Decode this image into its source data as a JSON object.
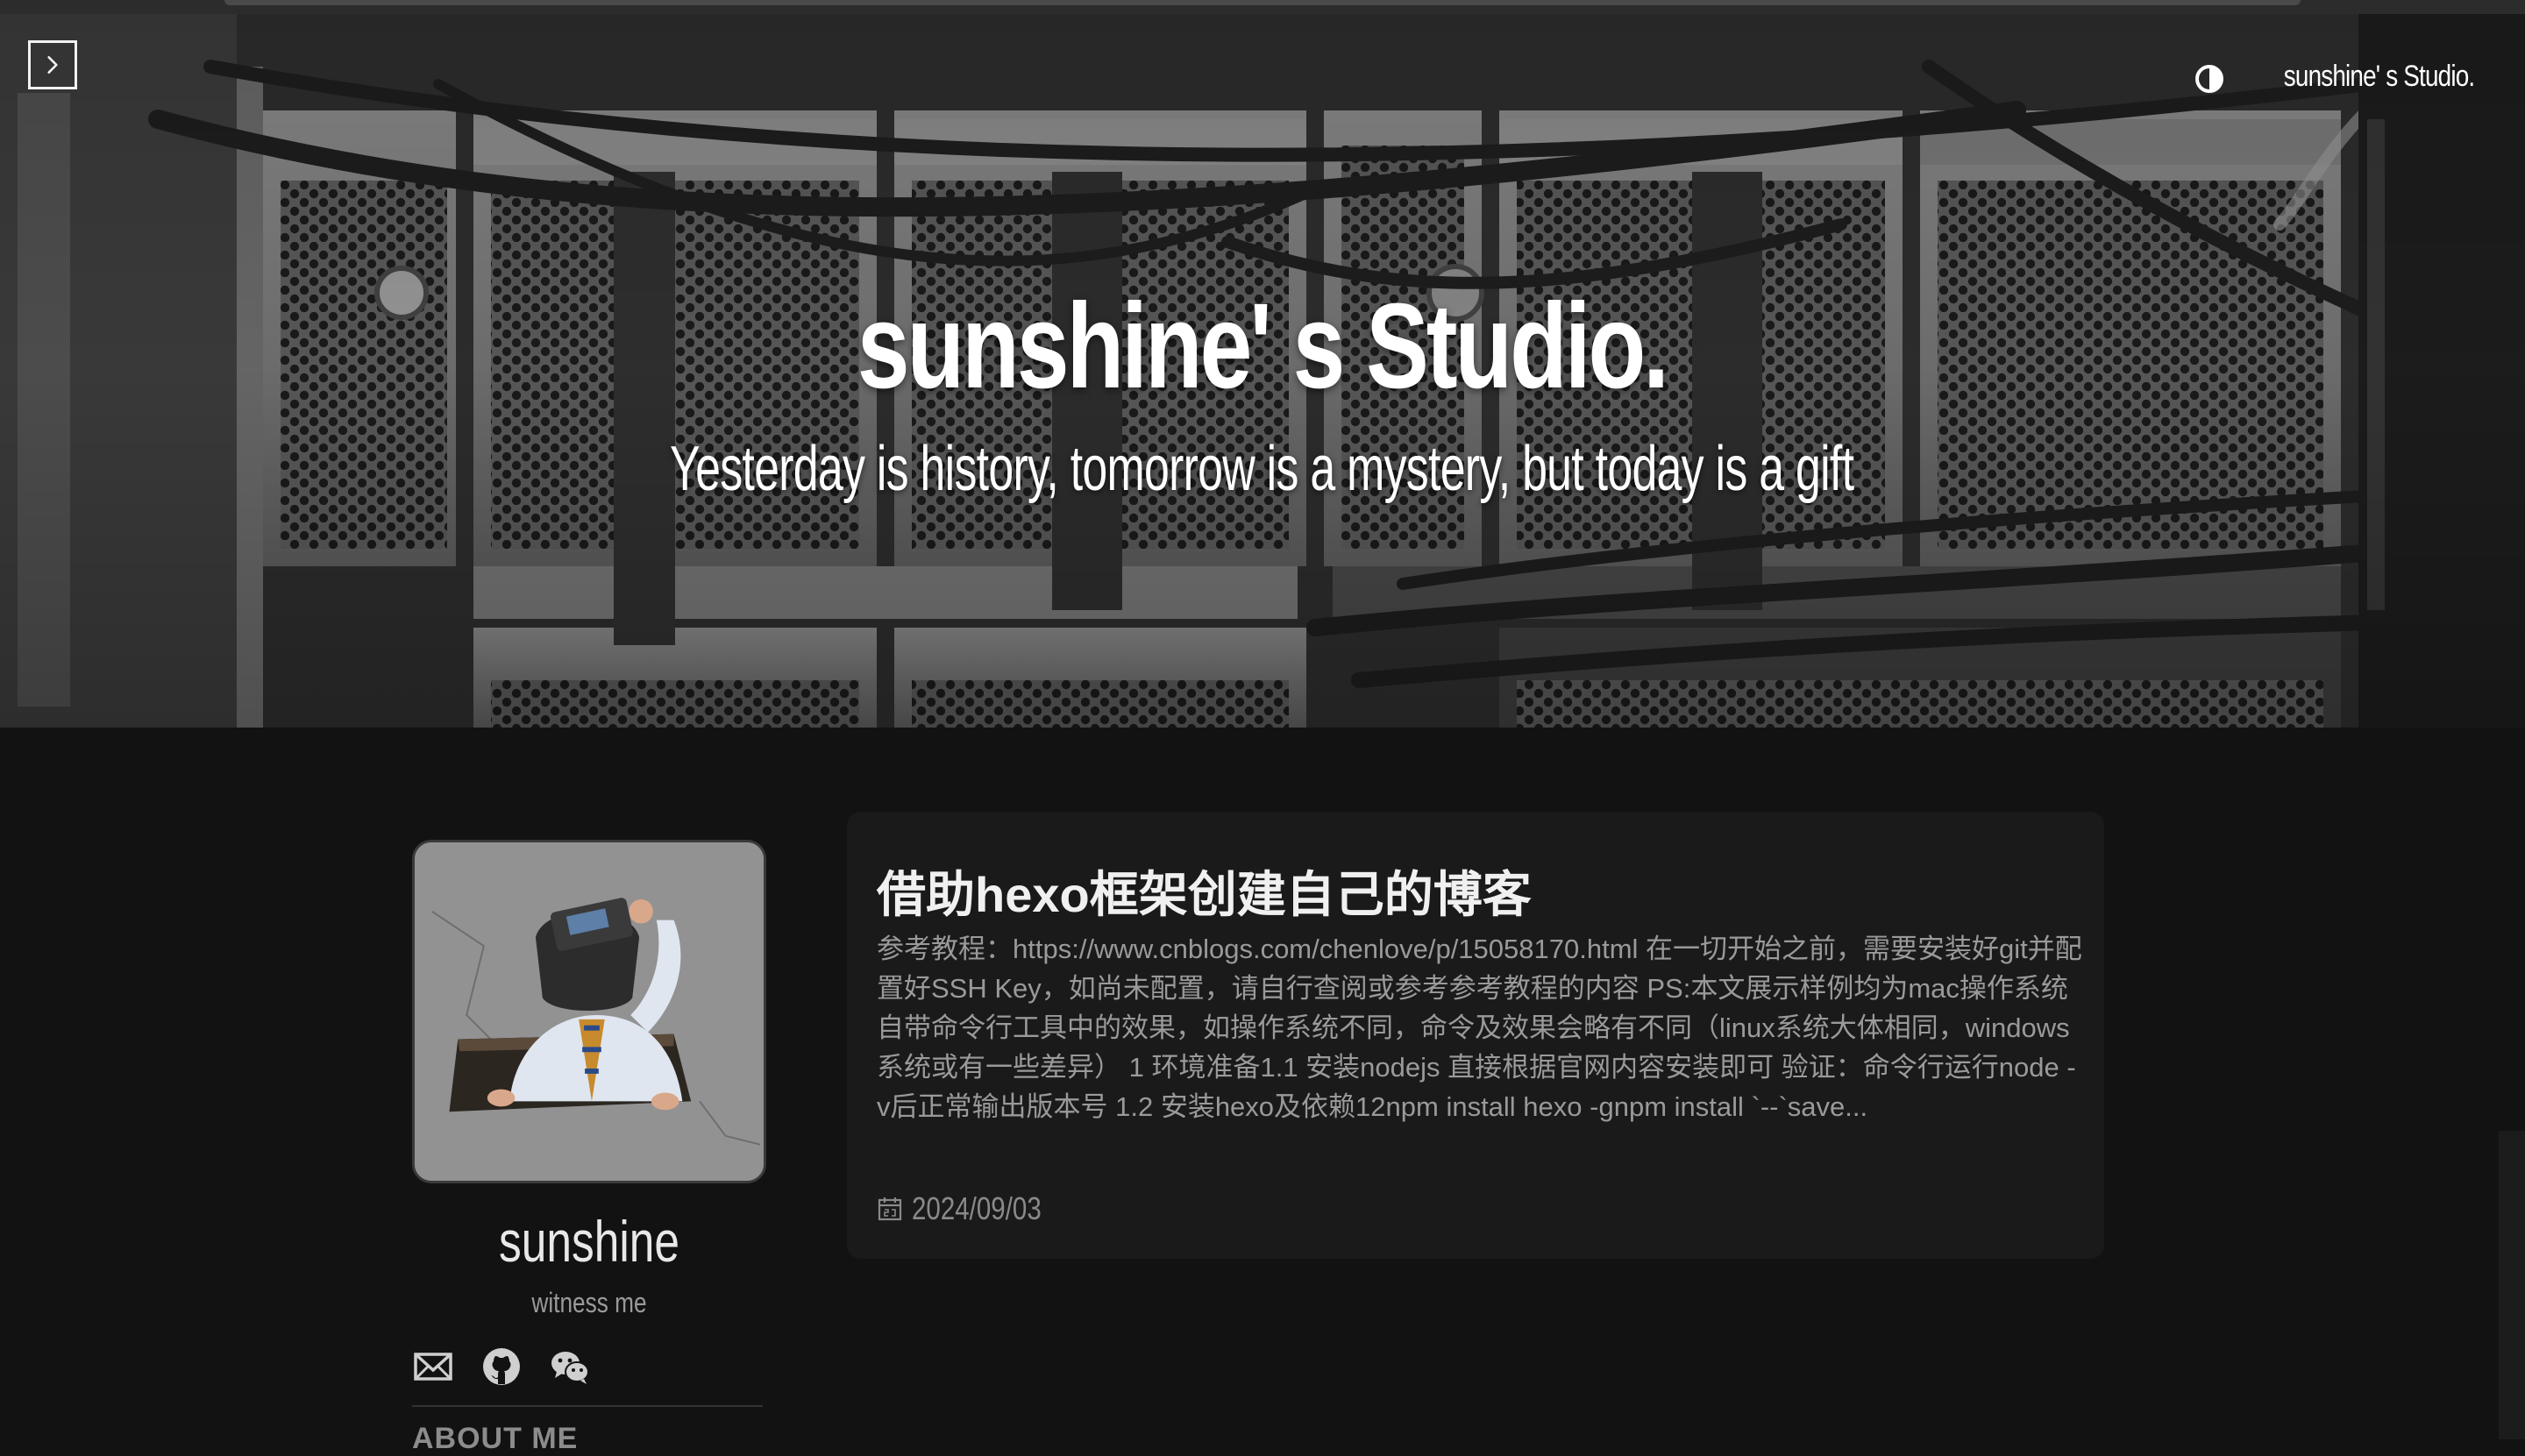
{
  "navbar": {
    "brand": "sunshine' s Studio.",
    "menu_icon": "chevron-right-icon",
    "theme_icon": "contrast-icon"
  },
  "hero": {
    "title": "sunshine' s Studio.",
    "subtitle": "Yesterday is history, tomorrow is a mystery, but today is a gift"
  },
  "sidebar": {
    "author_name": "sunshine",
    "author_description": "witness me",
    "social_icons": [
      "mail-icon",
      "github-icon",
      "wechat-icon"
    ],
    "about_heading": "ABOUT ME"
  },
  "post": {
    "title": "借助hexo框架创建自己的博客",
    "excerpt": "参考教程：https://www.cnblogs.com/chenlove/p/15058170.html 在一切开始之前，需要安装好git并配置好SSH Key，如尚未配置，请自行查阅或参考参考教程的内容 PS:本文展示样例均为mac操作系统自带命令行工具中的效果，如操作系统不同，命令及效果会略有不同（linux系统大体相同，windows系统或有一些差异） 1 环境准备1.1 安装nodejs 直接根据官网内容安装即可 验证：命令行运行node -v后正常输出版本号 1.2 安装hexo及依赖12npm install hexo -gnpm install `--`save...",
    "date": "2024/09/03",
    "date_icon": "calendar-icon"
  },
  "colors": {
    "background": "#121212",
    "card": "#1a1a1a",
    "text": "#f0f0f0",
    "muted": "#9a9a9a"
  }
}
